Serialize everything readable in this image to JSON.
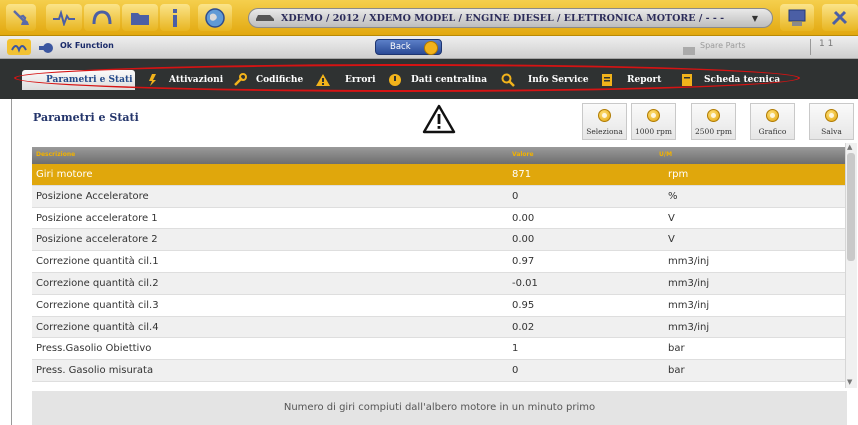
{
  "toolbar": {
    "icons": [
      "car-wrench-icon",
      "pulse-icon",
      "horseshoe-icon",
      "folder-icon",
      "info-icon",
      "globe-icon",
      "computer-icon",
      "tools-icon"
    ],
    "breadcrumb": "XDEMO / 2012 / XDEMO MODEL / ENGINE DIESEL / ELETTRONICA MOTORE / - - -"
  },
  "subbar": {
    "ok_function": "Ok Function",
    "back": "Back",
    "spare_parts": "Spare Parts",
    "right_text": "1 1"
  },
  "tabs": [
    {
      "label": "Parametri e Stati",
      "icon": "parameters-icon",
      "active": true
    },
    {
      "label": "Attivazioni",
      "icon": "activation-icon"
    },
    {
      "label": "Codifiche",
      "icon": "wrench-icon"
    },
    {
      "label": "Errori",
      "icon": "warning-icon"
    },
    {
      "label": "Dati centralina",
      "icon": "ecu-icon"
    },
    {
      "label": "Info Service",
      "icon": "search-icon"
    },
    {
      "label": "Report",
      "icon": "report-icon"
    },
    {
      "label": "Scheda tecnica",
      "icon": "datasheet-icon"
    }
  ],
  "panel": {
    "title": "Parametri e Stati",
    "actions": [
      {
        "label": "Seleziona",
        "icon": "select-icon"
      },
      {
        "label": "1000 rpm",
        "icon": "gauge-icon"
      },
      {
        "label": "2500 rpm",
        "icon": "gauge-icon"
      },
      {
        "label": "Grafico",
        "icon": "chart-icon"
      },
      {
        "label": "Salva",
        "icon": "save-icon"
      }
    ]
  },
  "table": {
    "headers": {
      "description": "Descrizione",
      "value": "Valore",
      "unit": "U/M"
    },
    "rows": [
      {
        "desc": "Giri motore",
        "value": "871",
        "unit": "rpm"
      },
      {
        "desc": "Posizione Acceleratore",
        "value": "0",
        "unit": "%"
      },
      {
        "desc": "Posizione acceleratore 1",
        "value": "0.00",
        "unit": "V"
      },
      {
        "desc": "Posizione acceleratore 2",
        "value": "0.00",
        "unit": "V"
      },
      {
        "desc": "Correzione quantità cil.1",
        "value": "0.97",
        "unit": "mm3/inj"
      },
      {
        "desc": "Correzione quantità cil.2",
        "value": "-0.01",
        "unit": "mm3/inj"
      },
      {
        "desc": "Correzione quantità cil.3",
        "value": "0.95",
        "unit": "mm3/inj"
      },
      {
        "desc": "Correzione quantità cil.4",
        "value": "0.02",
        "unit": "mm3/inj"
      },
      {
        "desc": "Press.Gasolio Obiettivo",
        "value": "1",
        "unit": "bar"
      },
      {
        "desc": "Press. Gasolio misurata",
        "value": "0",
        "unit": "bar"
      }
    ],
    "selected_row": 0
  },
  "description": "Numero di giri compiuti dall'albero motore in un minuto primo",
  "colors": {
    "accent": "#e0a70c",
    "tabbar": "#2f3232",
    "highlight_ellipse": "#d61313"
  }
}
